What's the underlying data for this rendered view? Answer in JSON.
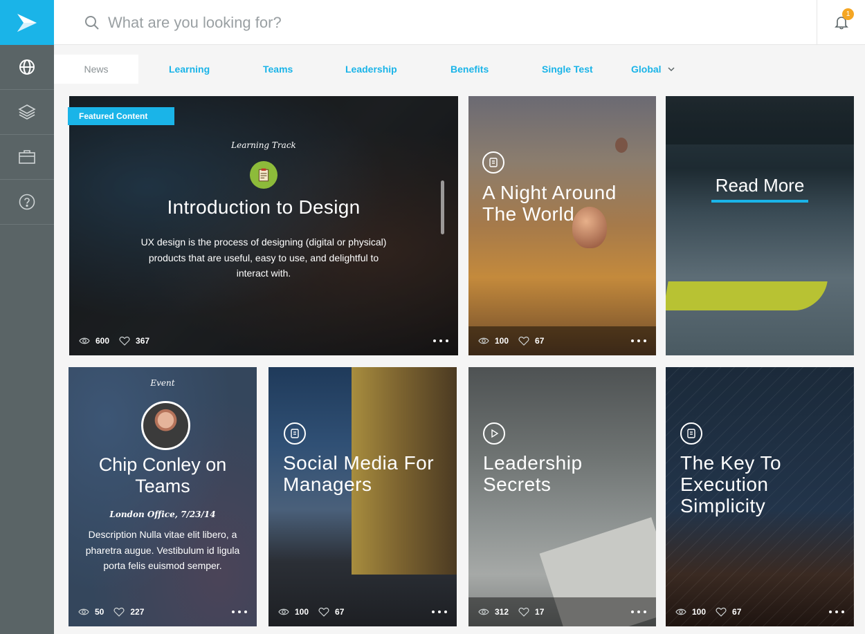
{
  "colors": {
    "accent": "#1ab4e8",
    "sidebar": "#5a6466",
    "badge": "#f5a623"
  },
  "search": {
    "placeholder": "What are you looking for?"
  },
  "notifications": {
    "count": "1"
  },
  "sidebar": {
    "items": [
      {
        "icon": "globe-icon"
      },
      {
        "icon": "layers-icon"
      },
      {
        "icon": "briefcase-icon"
      },
      {
        "icon": "help-icon"
      }
    ]
  },
  "tabs": [
    {
      "label": "News"
    },
    {
      "label": "Learning"
    },
    {
      "label": "Teams"
    },
    {
      "label": "Leadership"
    },
    {
      "label": "Benefits"
    },
    {
      "label": "Single Test"
    },
    {
      "label": "Global"
    }
  ],
  "cards": {
    "featured": {
      "tag": "Featured Content",
      "category": "Learning Track",
      "title": "Introduction to Design",
      "description": "UX design is the process of designing (digital or physical) products that  are useful, easy to use, and delightful to interact with.",
      "views": "600",
      "likes": "367"
    },
    "night": {
      "title": "A Night Around The World",
      "views": "100",
      "likes": "67"
    },
    "readmore": {
      "label": "Read More"
    },
    "chip": {
      "category": "Event",
      "title": "Chip Conley on Teams",
      "meta": "London Office,  7/23/14",
      "description": "Description Nulla vitae elit libero, a pharetra augue. Vestibulum id ligula porta felis euismod semper.",
      "views": "50",
      "likes": "227"
    },
    "social": {
      "title": "Social Media For Managers",
      "views": "100",
      "likes": "67"
    },
    "leadership": {
      "title": "Leadership Secrets",
      "views": "312",
      "likes": "17"
    },
    "execution": {
      "title": "The Key To Execution Simplicity",
      "views": "100",
      "likes": "67"
    }
  }
}
